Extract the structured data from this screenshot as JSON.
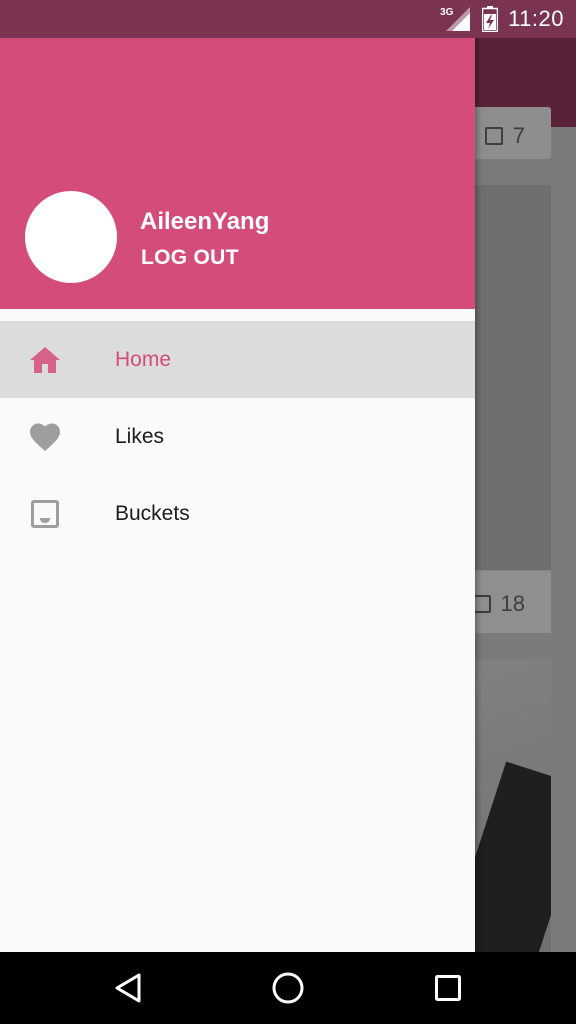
{
  "status_bar": {
    "network": "3G",
    "time": "11:20",
    "icons": [
      "signal-icon",
      "battery-charging-icon"
    ]
  },
  "drawer": {
    "user_name": "AileenYang",
    "logout_label": "LOG OUT",
    "menu_items": [
      {
        "label": "Home",
        "icon": "home-icon",
        "active": true
      },
      {
        "label": "Likes",
        "icon": "heart-icon",
        "active": false
      },
      {
        "label": "Buckets",
        "icon": "inbox-icon",
        "active": false
      }
    ]
  },
  "background": {
    "card_stats": [
      "7",
      "18"
    ]
  },
  "colors": {
    "accent": "#d44d7a",
    "status_bar": "#7a3350",
    "active_item_bg": "#dcdcdc",
    "icon_inactive": "#9e9e9e"
  },
  "nav_bar": {
    "buttons": [
      "back-icon",
      "home-circle-icon",
      "recents-icon"
    ]
  }
}
